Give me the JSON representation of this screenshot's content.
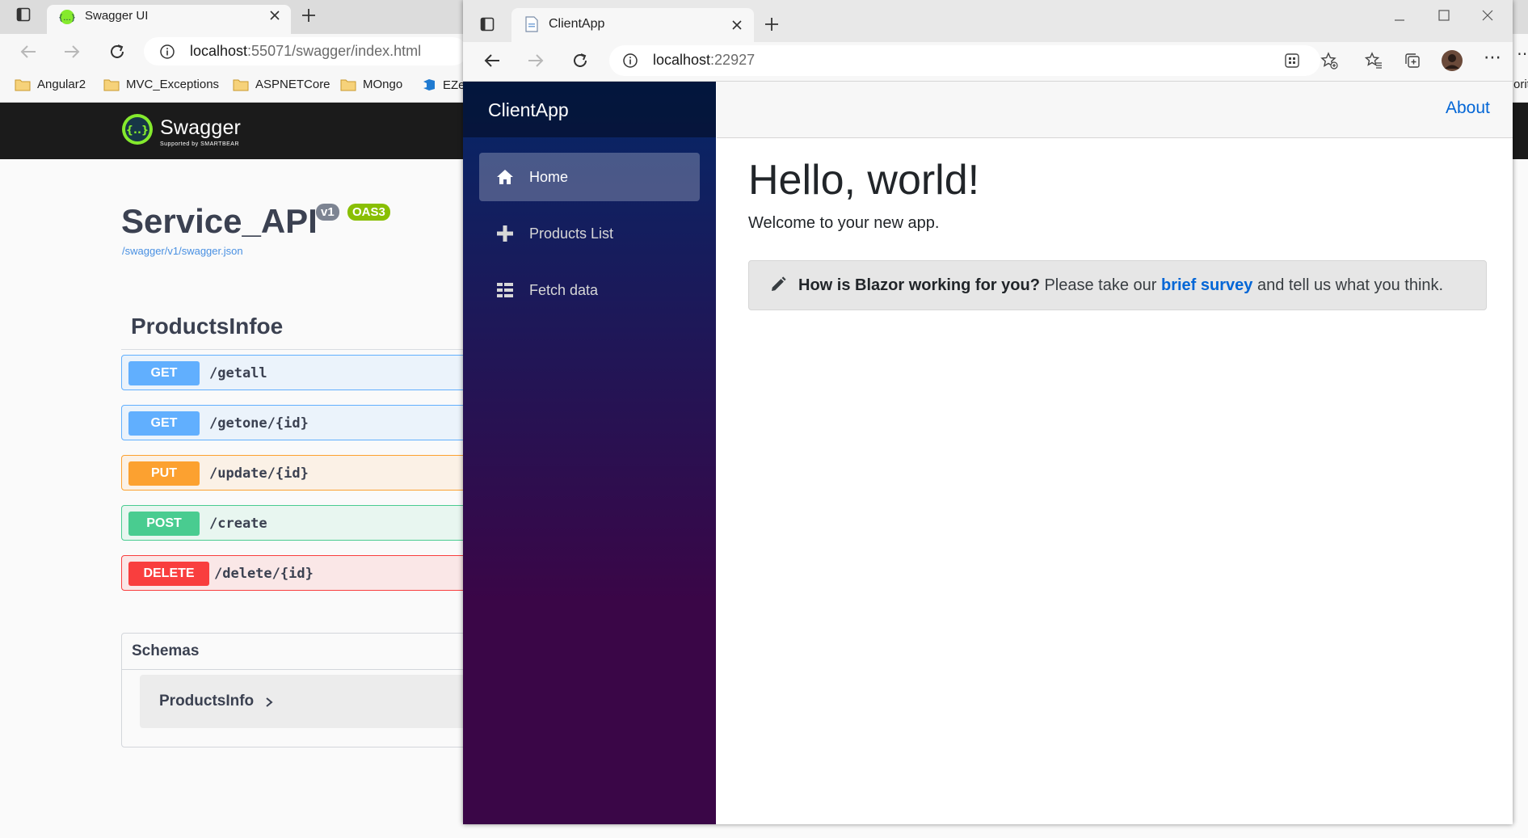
{
  "back_browser": {
    "tab_title": "Swagger UI",
    "address_host": "localhost",
    "address_rest": ":55071/swagger/index.html",
    "bookmarks": [
      "Angular2",
      "MVC_Exceptions",
      "ASPNETCore",
      "MOngo",
      "EZe"
    ],
    "overflow_text": "orite"
  },
  "swagger": {
    "brand": "Swagger",
    "brand_sub": "Supported by SMARTBEAR",
    "api_title": "Service_API",
    "version_badge": "v1",
    "oas_badge": "OAS3",
    "spec_link": "/swagger/v1/swagger.json",
    "group_title": "ProductsInfoe",
    "operations": [
      {
        "method": "GET",
        "path": "/getall",
        "color": "#61affe"
      },
      {
        "method": "GET",
        "path": "/getone/{id}",
        "color": "#61affe"
      },
      {
        "method": "PUT",
        "path": "/update/{id}",
        "color": "#fca130"
      },
      {
        "method": "POST",
        "path": "/create",
        "color": "#49cc90"
      },
      {
        "method": "DELETE",
        "path": "/delete/{id}",
        "color": "#f93e3e"
      }
    ],
    "schemas_title": "Schemas",
    "schema_item": "ProductsInfo"
  },
  "front_browser": {
    "tab_title": "ClientApp",
    "address_host": "localhost",
    "address_rest": ":22927"
  },
  "app": {
    "brand": "ClientApp",
    "nav": [
      {
        "label": "Home",
        "icon": "home-icon"
      },
      {
        "label": "Products List",
        "icon": "plus-icon"
      },
      {
        "label": "Fetch data",
        "icon": "list-icon"
      }
    ],
    "about": "About",
    "heading": "Hello, world!",
    "welcome": "Welcome to your new app.",
    "survey": {
      "question": "How is Blazor working for you?",
      "pre": " Please take our ",
      "link": "brief survey",
      "post": " and tell us what you think."
    }
  }
}
